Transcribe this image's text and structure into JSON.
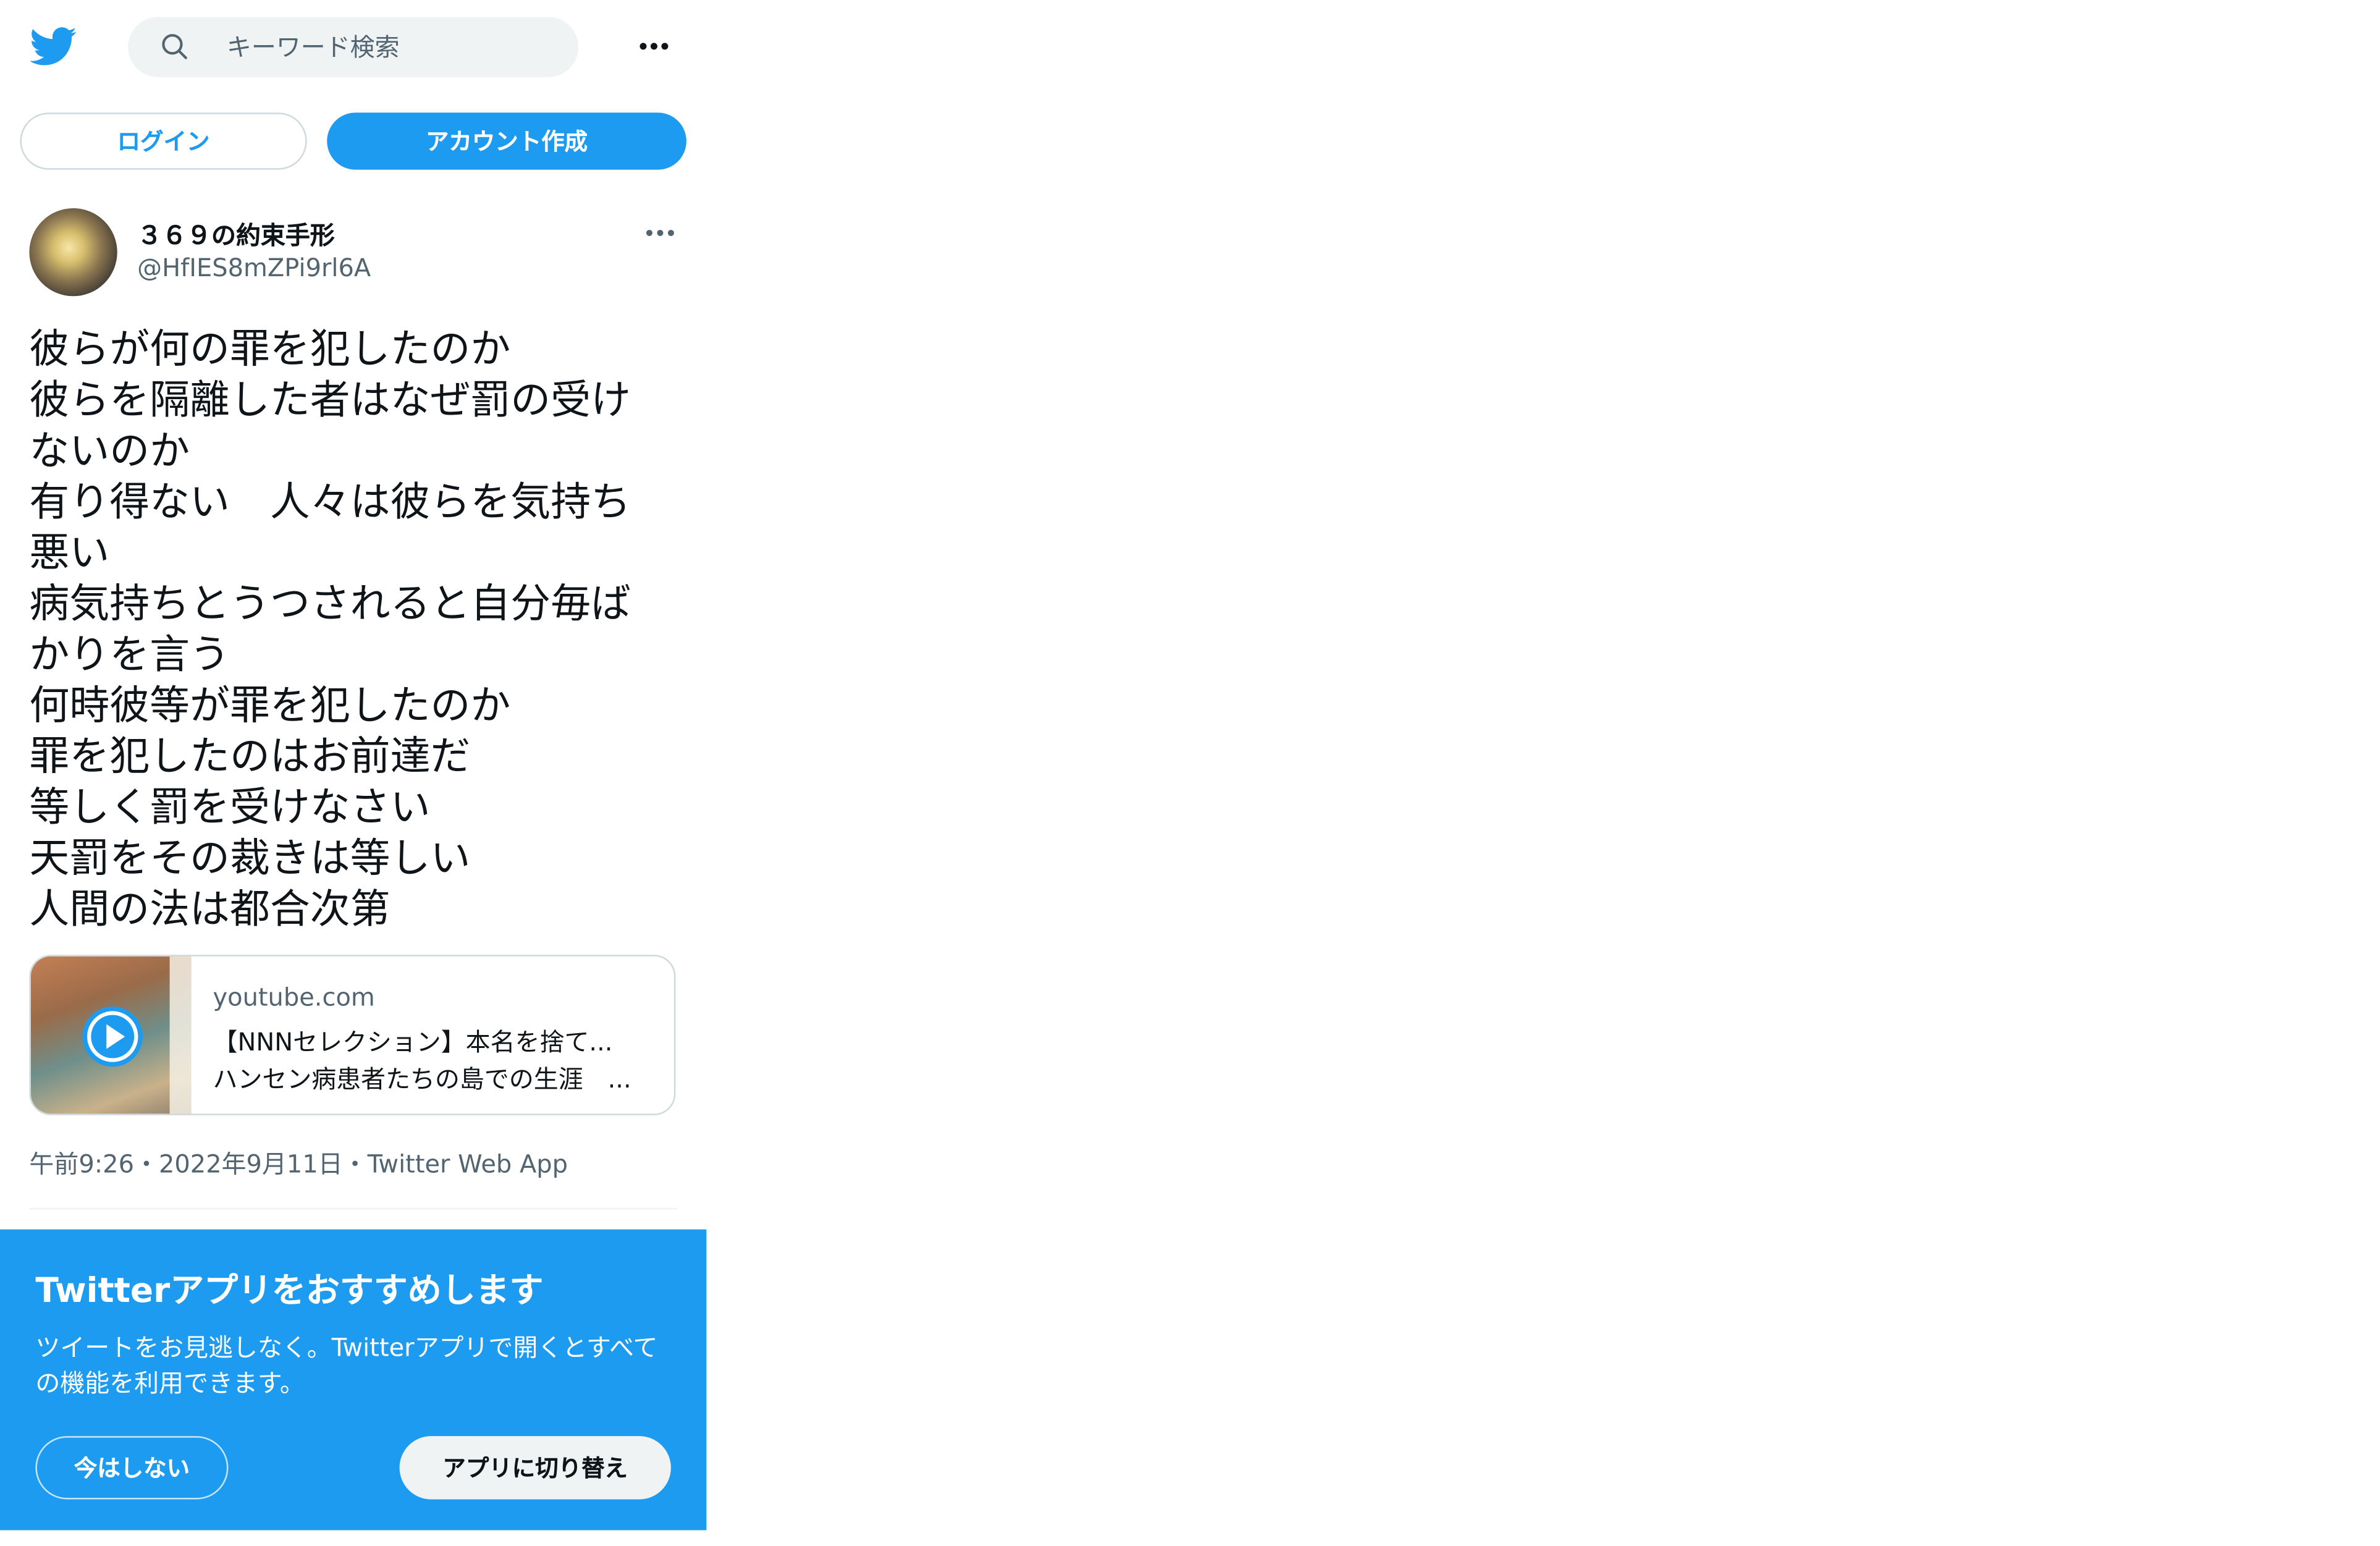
{
  "header": {
    "logo": "twitter-bird-icon",
    "search_placeholder": "キーワード検索",
    "more_icon": "more-horizontal-icon"
  },
  "auth": {
    "login_label": "ログイン",
    "signup_label": "アカウント作成"
  },
  "tweet": {
    "display_name": "３６９の約束手形",
    "handle": "@HfIES8mZPi9rl6A",
    "text_lines": [
      "彼らが何の罪を犯したのか",
      "彼らを隔離した者はなぜ罰の受け",
      "ないのか",
      "有り得ない　人々は彼らを気持ち",
      "悪い",
      "病気持ちとうつされると自分毎ば",
      "かりを言う",
      "何時彼等が罪を犯したのか",
      "罪を犯したのはお前達だ",
      "等しく罰を受けなさい",
      "天罰をその裁きは等しい",
      "人間の法は都合次第"
    ],
    "card": {
      "domain": "youtube.com",
      "title_line1": "【NNNセレクション】本名を捨て...",
      "title_line2": "ハンセン病患者たちの島での生涯　..."
    },
    "timestamp": "午前9:26・2022年9月11日・Twitter Web App"
  },
  "promo": {
    "title": "Twitterアプリをおすすめします",
    "body": "ツイートをお見逃しなく。Twitterアプリで開くとすべての機能を利用できます。",
    "later_label": "今はしない",
    "switch_label": "アプリに切り替え"
  },
  "colors": {
    "brand": "#1d9bf0",
    "text": "#0f1419",
    "secondary": "#536471"
  }
}
